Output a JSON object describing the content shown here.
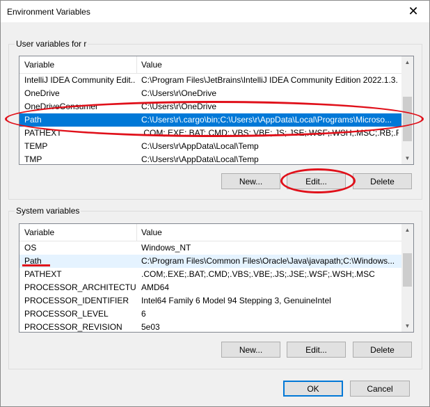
{
  "window": {
    "title": "Environment Variables",
    "close_glyph": "✕"
  },
  "user_vars": {
    "group_label": "User variables for r",
    "col_variable": "Variable",
    "col_value": "Value",
    "rows": [
      {
        "name": "IntelliJ IDEA Community Edit...",
        "value": "C:\\Program Files\\JetBrains\\IntelliJ IDEA Community Edition 2022.1.3..."
      },
      {
        "name": "OneDrive",
        "value": "C:\\Users\\r\\OneDrive"
      },
      {
        "name": "OneDriveConsumer",
        "value": "C:\\Users\\r\\OneDrive"
      },
      {
        "name": "Path",
        "value": "C:\\Users\\r\\.cargo\\bin;C:\\Users\\r\\AppData\\Local\\Programs\\Microso..."
      },
      {
        "name": "PATHEXT",
        "value": ".COM;.EXE;.BAT;.CMD;.VBS;.VBE;.JS;.JSE;.WSF;.WSH;.MSC;.RB;.RBW;..."
      },
      {
        "name": "TEMP",
        "value": "C:\\Users\\r\\AppData\\Local\\Temp"
      },
      {
        "name": "TMP",
        "value": "C:\\Users\\r\\AppData\\Local\\Temp"
      }
    ],
    "new_label": "New...",
    "edit_label": "Edit...",
    "delete_label": "Delete"
  },
  "system_vars": {
    "group_label": "System variables",
    "col_variable": "Variable",
    "col_value": "Value",
    "rows": [
      {
        "name": "OS",
        "value": "Windows_NT"
      },
      {
        "name": "Path",
        "value": "C:\\Program Files\\Common Files\\Oracle\\Java\\javapath;C:\\Windows..."
      },
      {
        "name": "PATHEXT",
        "value": ".COM;.EXE;.BAT;.CMD;.VBS;.VBE;.JS;.JSE;.WSF;.WSH;.MSC"
      },
      {
        "name": "PROCESSOR_ARCHITECTURE",
        "value": "AMD64"
      },
      {
        "name": "PROCESSOR_IDENTIFIER",
        "value": "Intel64 Family 6 Model 94 Stepping 3, GenuineIntel"
      },
      {
        "name": "PROCESSOR_LEVEL",
        "value": "6"
      },
      {
        "name": "PROCESSOR_REVISION",
        "value": "5e03"
      }
    ],
    "new_label": "New...",
    "edit_label": "Edit...",
    "delete_label": "Delete"
  },
  "footer": {
    "ok_label": "OK",
    "cancel_label": "Cancel"
  },
  "colors": {
    "selection": "#0078d7",
    "annotation": "#e0101a"
  }
}
